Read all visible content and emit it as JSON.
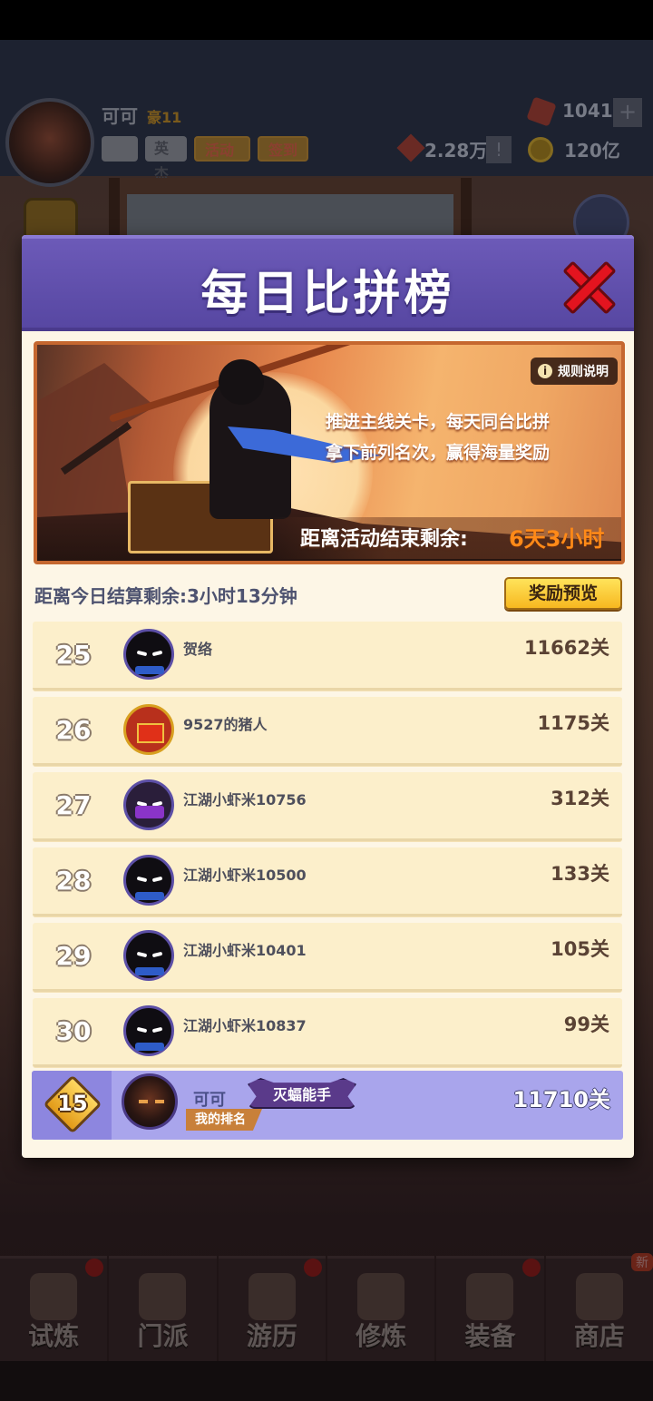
{
  "background": {
    "player_name": "可可",
    "vip_label": "豪11",
    "chips": {
      "hero": "英杰",
      "activity": "活动",
      "signin": "签到"
    },
    "gems": "1041",
    "power": "2.28万",
    "coins": "120亿"
  },
  "modal": {
    "title": "每日比拼榜",
    "banner": {
      "rules_label": "规则说明",
      "desc_line1": "推进主线关卡，每天同台比拼",
      "desc_line2": "拿下前列名次，赢得海量奖励",
      "countdown_label": "距离活动结束剩余:",
      "countdown_value": "6天3小时"
    },
    "settlement_text": "距离今日结算剩余:3小时13分钟",
    "reward_preview_label": "奖励预览",
    "ranks": [
      {
        "rank": "25",
        "name": "贺络",
        "score": "11662关"
      },
      {
        "rank": "26",
        "name": "9527的猪人",
        "score": "1175关"
      },
      {
        "rank": "27",
        "name": "江湖小虾米10756",
        "score": "312关"
      },
      {
        "rank": "28",
        "name": "江湖小虾米10500",
        "score": "133关"
      },
      {
        "rank": "29",
        "name": "江湖小虾米10401",
        "score": "105关"
      },
      {
        "rank": "30",
        "name": "江湖小虾米10837",
        "score": "99关"
      }
    ],
    "my_rank": {
      "rank": "15",
      "name": "可可",
      "title": "灭蝠能手",
      "label": "我的排名",
      "score": "11710关"
    }
  },
  "navbar": {
    "items": [
      {
        "label": "试炼",
        "icon": "ninja-icon"
      },
      {
        "label": "门派",
        "icon": "temple-icon"
      },
      {
        "label": "游历",
        "icon": "landscape-icon"
      },
      {
        "label": "修炼",
        "icon": "scroll-icon"
      },
      {
        "label": "装备",
        "icon": "swords-icon"
      },
      {
        "label": "商店",
        "icon": "shop-icon"
      }
    ],
    "new_badge": "新"
  },
  "colors": {
    "header_purple": "#6c5ab8",
    "close_red": "#e3141f",
    "countdown_orange": "#ff8a18",
    "reward_button_yellow": "#ffe35a",
    "row_bg": "#fcefcb",
    "my_rank_bg": "#a9a5ec"
  }
}
